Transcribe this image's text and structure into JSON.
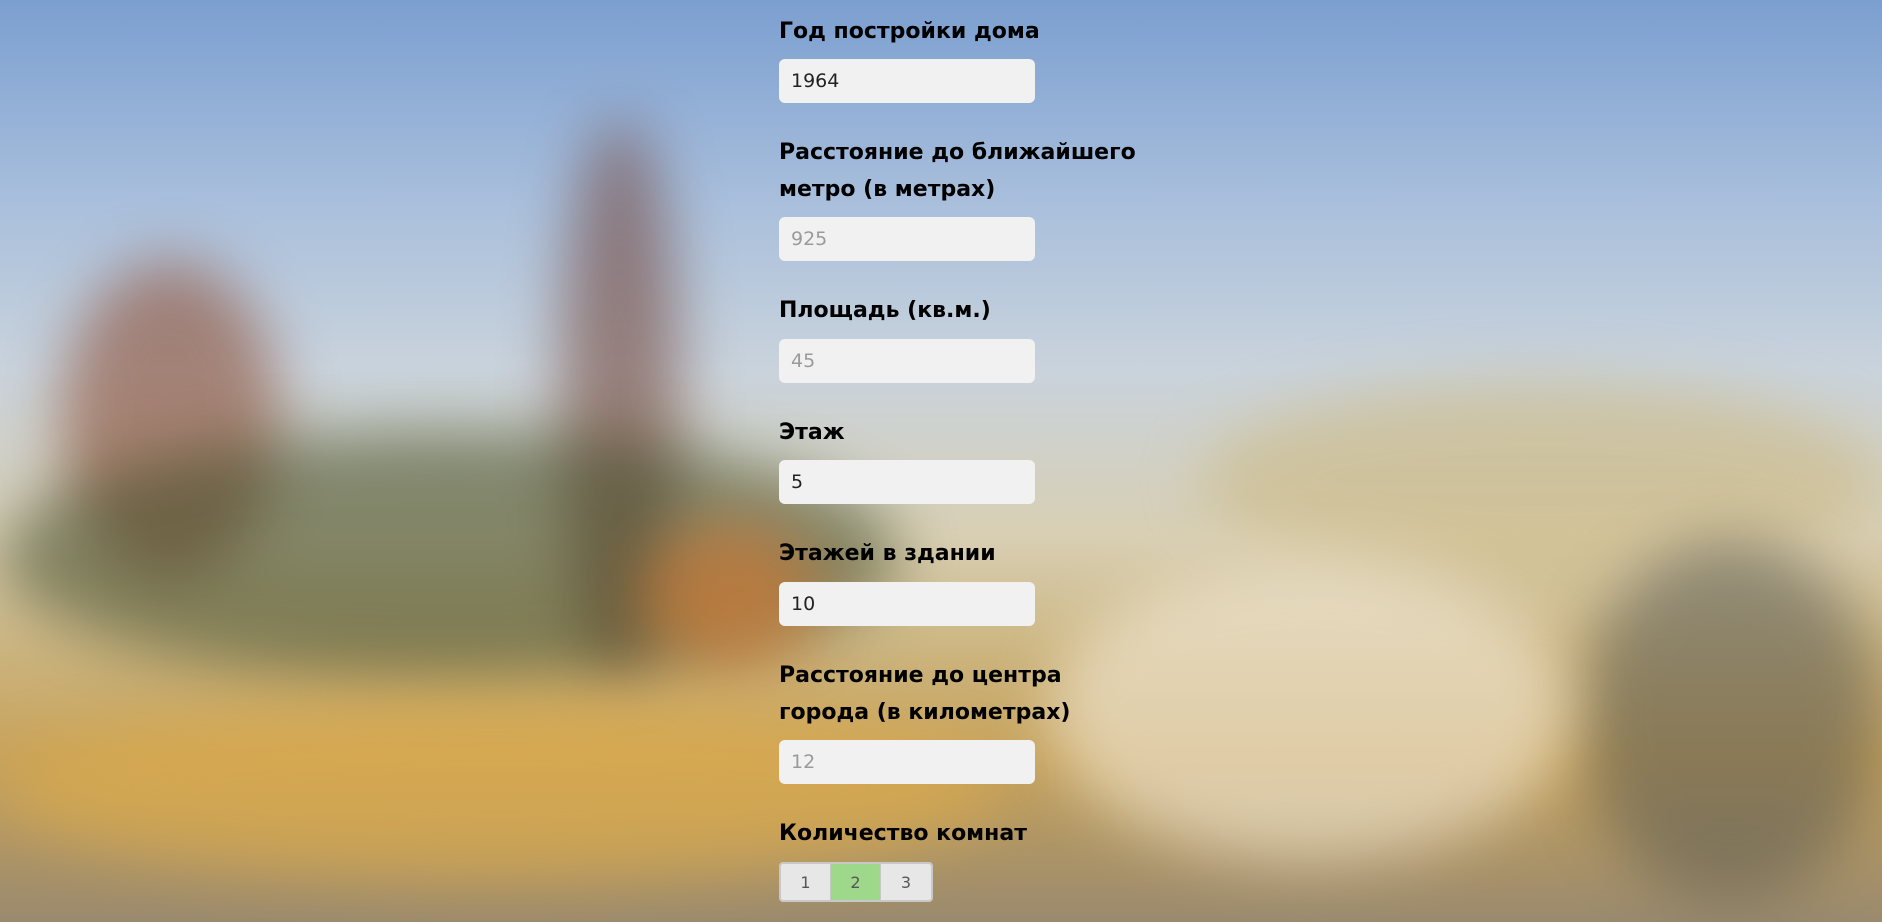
{
  "fields": [
    {
      "label": "Год постройки дома",
      "value": "1964",
      "placeholder": ""
    },
    {
      "label": "Расстояние до ближайшего метро (в метрах)",
      "value": "",
      "placeholder": "925"
    },
    {
      "label": "Площадь (кв.м.)",
      "value": "",
      "placeholder": "45"
    },
    {
      "label": "Этаж",
      "value": "5",
      "placeholder": ""
    },
    {
      "label": "Этажей в здании",
      "value": "10",
      "placeholder": ""
    },
    {
      "label": "Расстояние до центра города (в километрах)",
      "value": "",
      "placeholder": "12"
    }
  ],
  "rooms": {
    "label": "Количество комнат",
    "options": [
      "1",
      "2",
      "3"
    ],
    "selected": "2"
  },
  "colors": {
    "selected_room": "#9ed88a",
    "input_background": "#f1f1f2"
  }
}
